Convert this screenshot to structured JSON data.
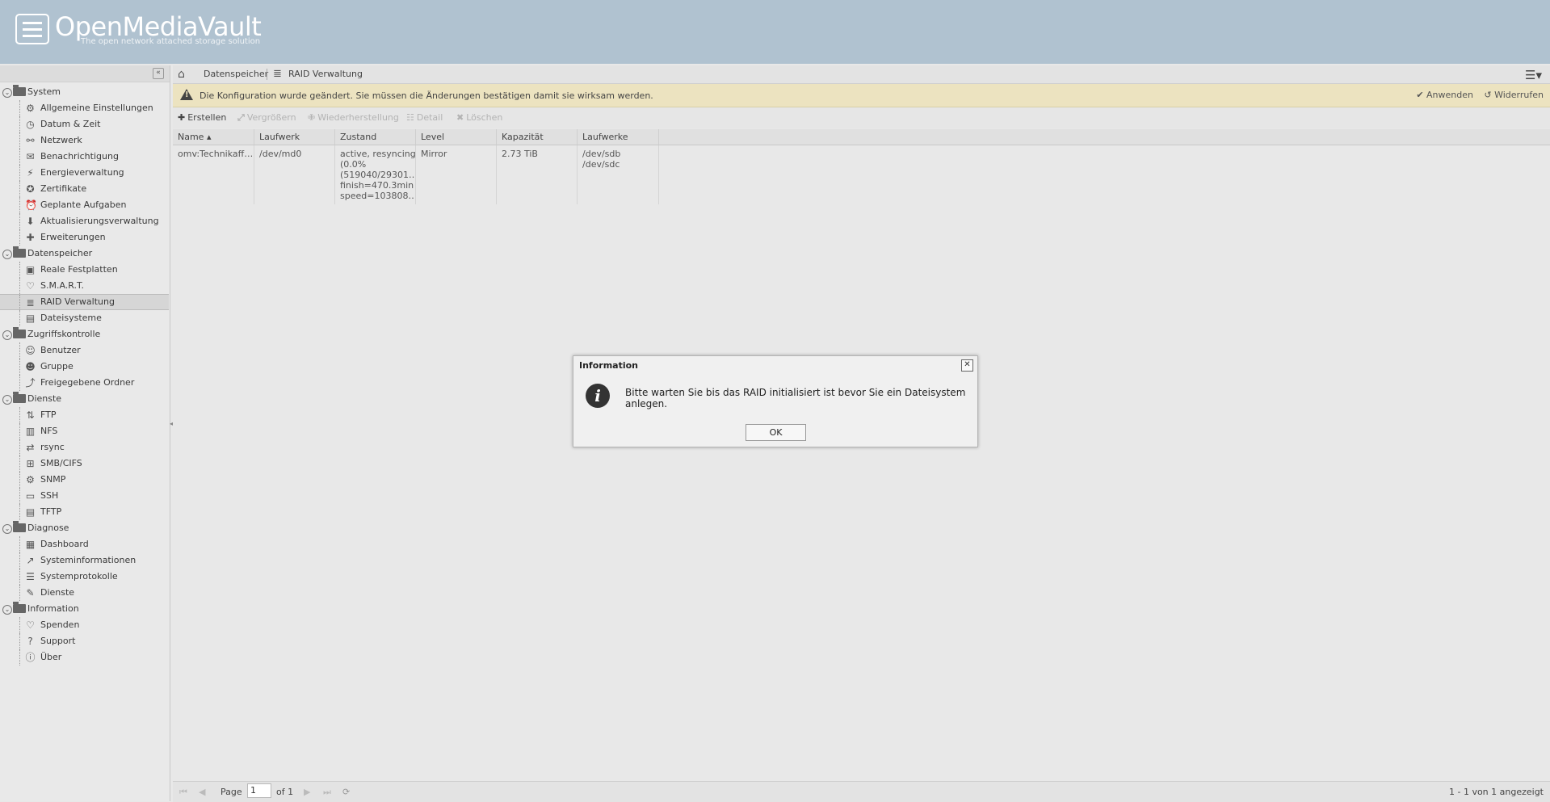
{
  "header": {
    "brand": "OpenMediaVault",
    "tagline": "The open network attached storage solution"
  },
  "sidebar": {
    "collapse_glyph": "«",
    "groups": [
      {
        "label": "System",
        "items": [
          "Allgemeine Einstellungen",
          "Datum & Zeit",
          "Netzwerk",
          "Benachrichtigung",
          "Energieverwaltung",
          "Zertifikate",
          "Geplante Aufgaben",
          "Aktualisierungsverwaltung",
          "Erweiterungen"
        ]
      },
      {
        "label": "Datenspeicher",
        "items": [
          "Reale Festplatten",
          "S.M.A.R.T.",
          "RAID Verwaltung",
          "Dateisysteme"
        ]
      },
      {
        "label": "Zugriffskontrolle",
        "items": [
          "Benutzer",
          "Gruppe",
          "Freigegebene Ordner"
        ]
      },
      {
        "label": "Dienste",
        "items": [
          "FTP",
          "NFS",
          "rsync",
          "SMB/CIFS",
          "SNMP",
          "SSH",
          "TFTP"
        ]
      },
      {
        "label": "Diagnose",
        "items": [
          "Dashboard",
          "Systeminformationen",
          "Systemprotokolle",
          "Dienste"
        ]
      },
      {
        "label": "Information",
        "items": [
          "Spenden",
          "Support",
          "Über"
        ]
      }
    ],
    "selected": "RAID Verwaltung"
  },
  "breadcrumb": {
    "c1": "Datenspeicher",
    "c2": "RAID Verwaltung"
  },
  "notice": {
    "message": "Die Konfiguration wurde geändert. Sie müssen die Änderungen bestätigen damit sie wirksam werden.",
    "apply": "Anwenden",
    "undo": "Widerrufen"
  },
  "toolbar": {
    "create": "Erstellen",
    "grow": "Vergrößern",
    "recover": "Wiederherstellung",
    "detail": "Detail",
    "delete": "Löschen"
  },
  "grid": {
    "headers": {
      "name": "Name ▴",
      "device": "Laufwerk",
      "state": "Zustand",
      "level": "Level",
      "capacity": "Kapazität",
      "devices": "Laufwerke"
    },
    "row": {
      "name": "omv:Technikaff…",
      "device": "/dev/md0",
      "state1": "active, resyncing",
      "state2": "(0.0%",
      "state3": "(519040/29301…",
      "state4": "finish=470.3min",
      "state5": "speed=103808…",
      "level": "Mirror",
      "capacity": "2.73 TiB",
      "dev1": "/dev/sdb",
      "dev2": "/dev/sdc"
    }
  },
  "pager": {
    "page_label": "Page",
    "page_value": "1",
    "of_label": "of 1",
    "info": "1 - 1 von 1 angezeigt"
  },
  "dialog": {
    "title": "Information",
    "message": "Bitte warten Sie bis das RAID initialisiert ist bevor Sie ein Dateisystem anlegen.",
    "ok": "OK"
  }
}
